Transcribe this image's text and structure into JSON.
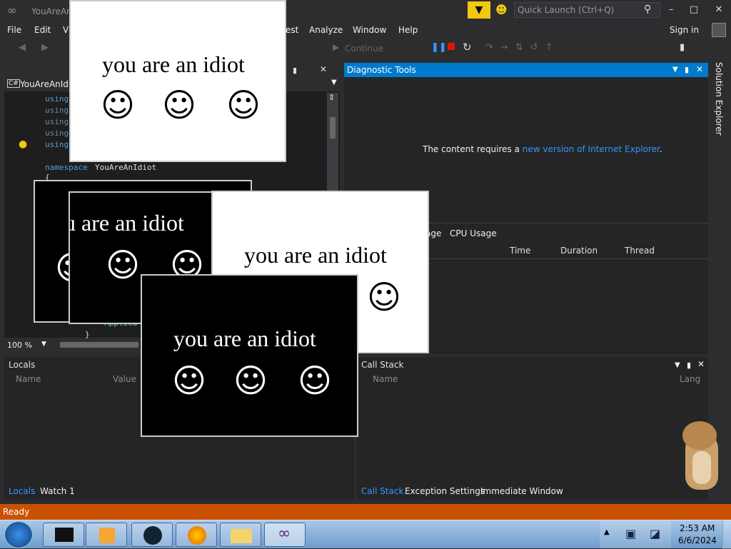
{
  "titlebar": {
    "title": "YouAreAn",
    "quick_launch_placeholder": "Quick Launch (Ctrl+Q)",
    "minimize": "–",
    "maximize": "□",
    "close": "✕"
  },
  "menu": {
    "file": "File",
    "edit": "Edit",
    "view": "V",
    "test": "est",
    "analyze": "Analyze",
    "window": "Window",
    "help": "Help",
    "sign_in": "Sign in"
  },
  "toolbar": {
    "continue": "Continue"
  },
  "editor": {
    "tab_label": "YouAreAnIdi",
    "lines": [
      "using",
      "using",
      "using",
      "using",
      "using"
    ],
    "namespace_kw": "namespace",
    "namespace_name": "YouAreAnIdiot",
    "brace_open": "{",
    "applica_fragment": "Applica",
    "brace_close": "}",
    "zoom": "100 %"
  },
  "diagnostic": {
    "title": "Diagnostic Tools",
    "message_prefix": "The content requires a ",
    "message_link": "new version of Internet Explorer",
    "message_suffix": ".",
    "tab_memory_fragment": "age",
    "tab_cpu": "CPU Usage",
    "col_time": "Time",
    "col_duration": "Duration",
    "col_thread": "Thread"
  },
  "side": {
    "solution_explorer": "Solution Explorer"
  },
  "locals": {
    "title": "Locals",
    "col_name": "Name",
    "col_value": "Value",
    "tab_locals": "Locals",
    "tab_watch": "Watch 1"
  },
  "callstack": {
    "title": "Call Stack",
    "col_name": "Name",
    "col_lang": "Lang",
    "tab_callstack": "Call Stack",
    "tab_exceptions": "Exception Settings",
    "tab_immediate": "Immediate Window"
  },
  "status": {
    "text": "Ready"
  },
  "popups": {
    "text": "you are an idiot",
    "text_cut": "u are an idiot",
    "smiley": "☺"
  },
  "taskbar": {
    "time": "2:53 AM",
    "date": "6/6/2024"
  },
  "colors": {
    "vs_accent": "#007acc",
    "status_orange": "#ca5100",
    "link_blue": "#3794ff"
  }
}
